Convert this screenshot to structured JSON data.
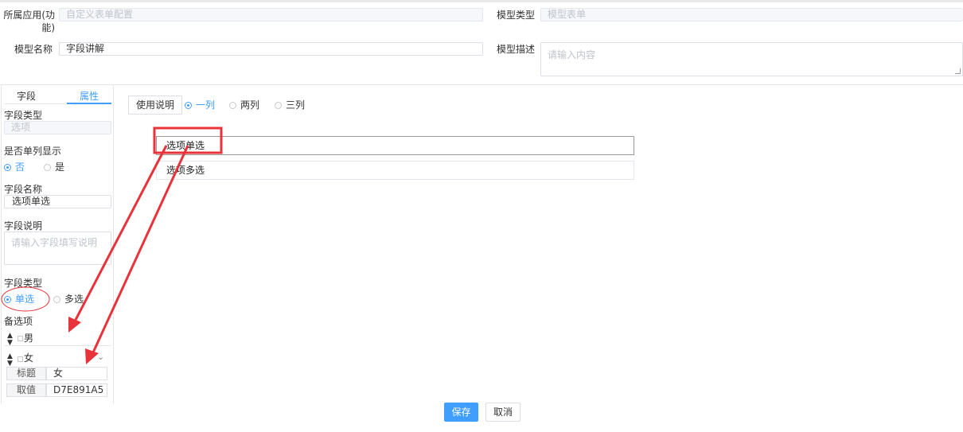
{
  "header": {
    "app_label": "所属应用(功能)",
    "app_label_line1": "所属应用(功",
    "app_label_line2": "能)",
    "app_value": "自定义表单配置",
    "model_type_label": "模型类型",
    "model_type_value": "模型表单",
    "model_name_label": "模型名称",
    "model_name_value": "字段讲解",
    "model_desc_label": "模型描述",
    "model_desc_placeholder": "请输入内容"
  },
  "left_panel": {
    "tabs": [
      {
        "label": "字段",
        "active": false
      },
      {
        "label": "属性",
        "active": true
      }
    ],
    "field_type_label": "字段类型",
    "field_type_value": "选项",
    "single_col_label": "是否单列显示",
    "single_col_options": [
      {
        "label": "否",
        "checked": true
      },
      {
        "label": "是",
        "checked": false
      }
    ],
    "field_name_label": "字段名称",
    "field_name_value": "选项单选",
    "field_desc_label": "字段说明",
    "field_desc_placeholder": "请输入字段填写说明",
    "choice_type_label": "字段类型",
    "choice_type_options": [
      {
        "label": "单选",
        "checked": true
      },
      {
        "label": "多选",
        "checked": false
      }
    ],
    "options_label": "备选项",
    "options": [
      {
        "text": "男",
        "expanded": false
      },
      {
        "text": "女",
        "expanded": true,
        "title_label": "标题",
        "title_value": "女",
        "value_label": "取值",
        "value_value": "D7E891A5"
      }
    ]
  },
  "canvas": {
    "usage_button": "使用说明",
    "column_options": [
      {
        "label": "一列",
        "checked": true
      },
      {
        "label": "两列",
        "checked": false
      },
      {
        "label": "三列",
        "checked": false
      }
    ],
    "fields": [
      {
        "label": "选项单选",
        "selected": true
      },
      {
        "label": "选项多选",
        "selected": false
      }
    ]
  },
  "footer": {
    "save_label": "保存",
    "cancel_label": "取消"
  },
  "colors": {
    "accent": "#409eff",
    "annotation": "#e8333a"
  }
}
